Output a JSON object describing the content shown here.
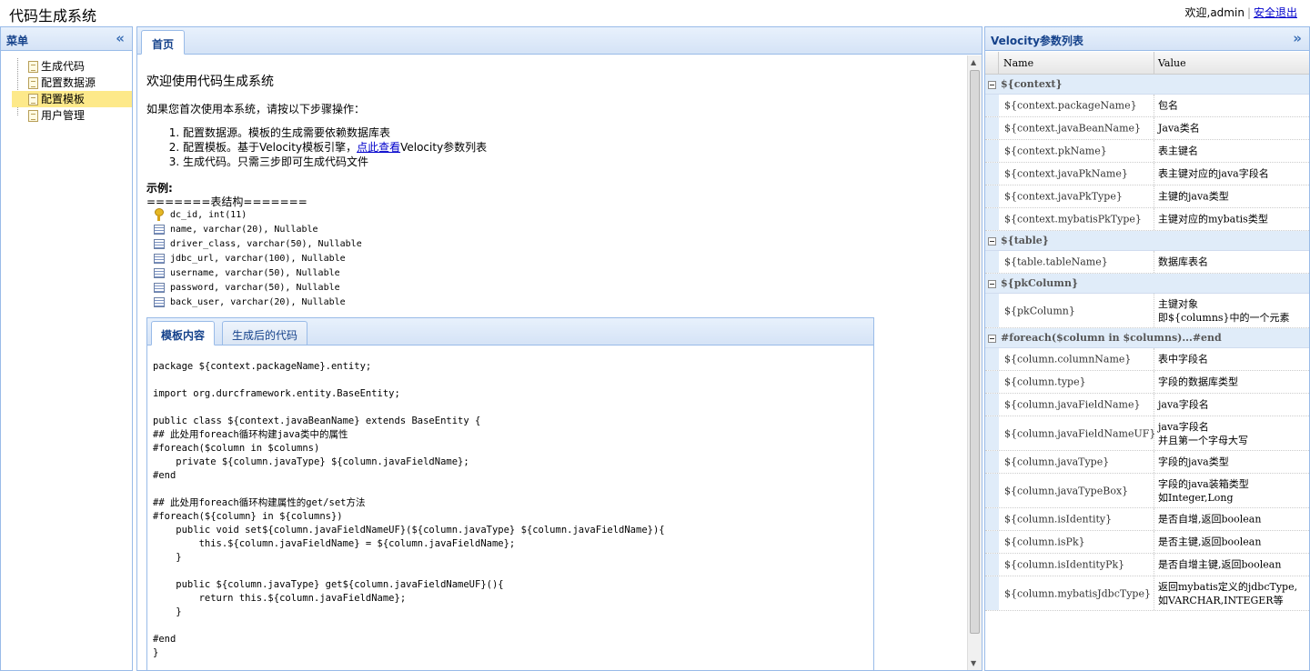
{
  "app": {
    "title": "代码生成系统"
  },
  "user": {
    "greeting": "欢迎,admin",
    "separator": "|",
    "logout": "安全退出"
  },
  "menu": {
    "title": "菜单",
    "items": [
      {
        "label": "生成代码"
      },
      {
        "label": "配置数据源"
      },
      {
        "label": "配置模板"
      },
      {
        "label": "用户管理"
      }
    ]
  },
  "center": {
    "tab_home": "首页",
    "welcome": "欢迎使用代码生成系统",
    "intro": "如果您首次使用本系统，请按以下步骤操作：",
    "steps": [
      {
        "text": "配置数据源。模板的生成需要依赖数据库表"
      },
      {
        "before": "配置模板。基于Velocity模板引擎，",
        "link": "点此查看",
        "after": "Velocity参数列表"
      },
      {
        "text": "生成代码。只需三步即可生成代码文件"
      }
    ],
    "example_title": "示例:",
    "struct_head": "=======表结构=======",
    "fields": [
      "dc_id, int(11)",
      "name, varchar(20), Nullable",
      "driver_class, varchar(50), Nullable",
      "jdbc_url, varchar(100), Nullable",
      "username, varchar(50), Nullable",
      "password, varchar(50), Nullable",
      "back_user, varchar(20), Nullable"
    ],
    "code_tabs": {
      "template": "模板内容",
      "generated": "生成后的代码"
    },
    "code": "package ${context.packageName}.entity;\n\nimport org.durcframework.entity.BaseEntity;\n\npublic class ${context.javaBeanName} extends BaseEntity {\n## 此处用foreach循环构建java类中的属性\n#foreach($column in $columns)\n    private ${column.javaType} ${column.javaFieldName};\n#end\n\n## 此处用foreach循环构建属性的get/set方法\n#foreach(${column} in ${columns})\n    public void set${column.javaFieldNameUF}(${column.javaType} ${column.javaFieldName}){\n        this.${column.javaFieldName} = ${column.javaFieldName};\n    }\n\n    public ${column.javaType} get${column.javaFieldNameUF}(){\n        return this.${column.javaFieldName};\n    }\n\n#end\n}"
  },
  "params": {
    "title": "Velocity参数列表",
    "col_name": "Name",
    "col_value": "Value",
    "groups": [
      {
        "name": "${context}",
        "rows": [
          {
            "k": "${context.packageName}",
            "v": "包名"
          },
          {
            "k": "${context.javaBeanName}",
            "v": "Java类名"
          },
          {
            "k": "${context.pkName}",
            "v": "表主键名"
          },
          {
            "k": "${context.javaPkName}",
            "v": "表主键对应的java字段名"
          },
          {
            "k": "${context.javaPkType}",
            "v": "主键的java类型"
          },
          {
            "k": "${context.mybatisPkType}",
            "v": "主键对应的mybatis类型"
          }
        ]
      },
      {
        "name": "${table}",
        "rows": [
          {
            "k": "${table.tableName}",
            "v": "数据库表名"
          }
        ]
      },
      {
        "name": "${pkColumn}",
        "rows": [
          {
            "k": "${pkColumn}",
            "v": "主键对象",
            "v2": "即${columns}中的一个元素"
          }
        ]
      },
      {
        "name": "#foreach($column in $columns)...#end",
        "rows": [
          {
            "k": "${column.columnName}",
            "v": "表中字段名"
          },
          {
            "k": "${column.type}",
            "v": "字段的数据库类型"
          },
          {
            "k": "${column.javaFieldName}",
            "v": "java字段名"
          },
          {
            "k": "${column.javaFieldNameUF}",
            "v": "java字段名",
            "v2": "并且第一个字母大写"
          },
          {
            "k": "${column.javaType}",
            "v": "字段的java类型"
          },
          {
            "k": "${column.javaTypeBox}",
            "v": "字段的java装箱类型",
            "v2": "如Integer,Long"
          },
          {
            "k": "${column.isIdentity}",
            "v": "是否自增,返回boolean"
          },
          {
            "k": "${column.isPk}",
            "v": "是否主键,返回boolean"
          },
          {
            "k": "${column.isIdentityPk}",
            "v": "是否自增主键,返回boolean"
          },
          {
            "k": "${column.mybatisJdbcType}",
            "v": "返回mybatis定义的jdbcType,",
            "v2": "如VARCHAR,INTEGER等"
          }
        ]
      }
    ]
  }
}
